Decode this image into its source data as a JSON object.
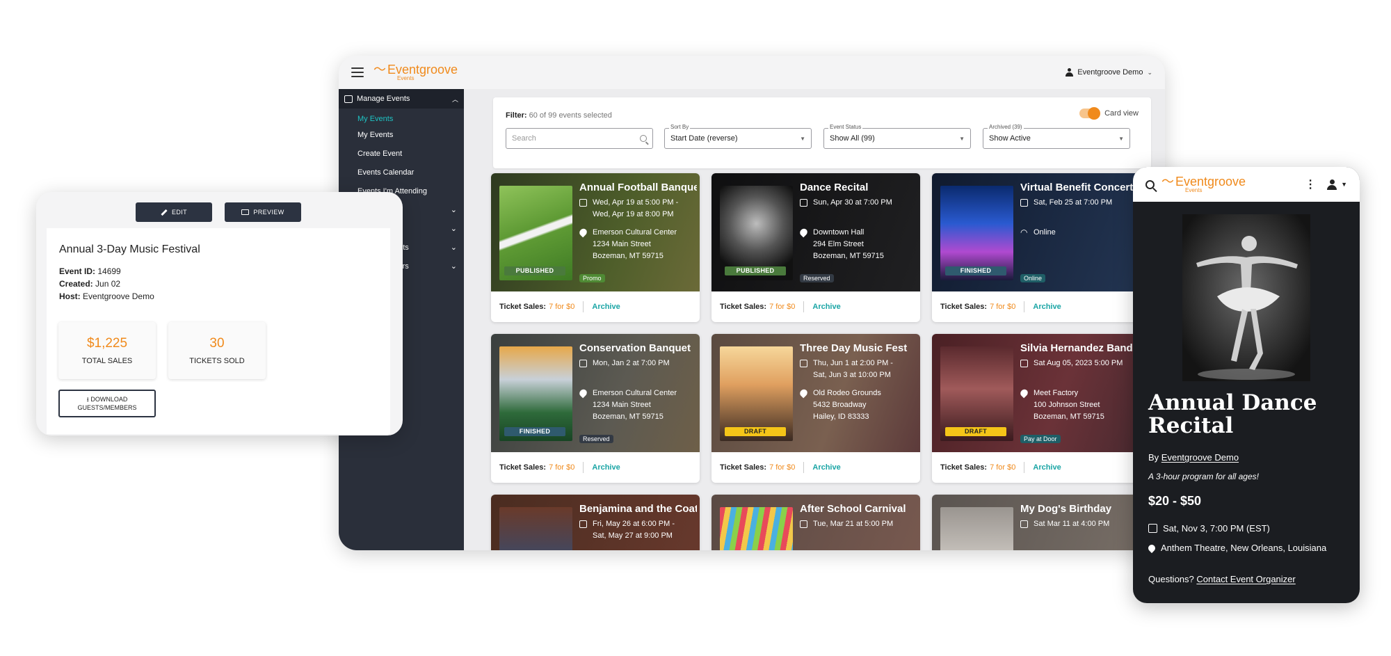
{
  "desktop": {
    "brand": "Eventgroove",
    "brand_sub": "Events",
    "user": "Eventgroove Demo",
    "sidebar": {
      "section": "Manage Events",
      "items": [
        "My Events",
        "My Events",
        "Create Event",
        "Events Calendar",
        "Events I'm Attending"
      ],
      "extra": [
        "",
        "",
        "ports",
        "Users"
      ]
    },
    "filter": {
      "label": "Filter:",
      "count": "60 of 99 events selected",
      "card_view": "Card view",
      "search_placeholder": "Search",
      "sort_label": "Sort By",
      "sort_value": "Start Date (reverse)",
      "status_label": "Event Status",
      "status_value": "Show All (99)",
      "archived_label": "Archived (39)",
      "archived_value": "Show Active"
    },
    "events": [
      {
        "title": "Annual Football Banquet",
        "date1": "Wed, Apr 19 at 5:00 PM -",
        "date2": "Wed, Apr 19 at 8:00 PM",
        "loc1": "Emerson Cultural Center",
        "loc2": "1234 Main Street",
        "loc3": "Bozeman, MT 59715",
        "status": "PUBLISHED",
        "tag": "Promo"
      },
      {
        "title": "Dance Recital",
        "date1": "Sun, Apr 30 at 7:00 PM",
        "date2": "",
        "loc1": "Downtown Hall",
        "loc2": "294 Elm Street",
        "loc3": "Bozeman, MT 59715",
        "status": "PUBLISHED",
        "tag": "Reserved"
      },
      {
        "title": "Virtual Benefit Concert",
        "date1": "Sat, Feb 25 at 7:00 PM",
        "date2": "",
        "loc1": "Online",
        "loc2": "",
        "loc3": "",
        "status": "FINISHED",
        "tag": "Online"
      },
      {
        "title": "Conservation Banquet",
        "date1": "Mon, Jan 2 at 7:00 PM",
        "date2": "",
        "loc1": "Emerson Cultural Center",
        "loc2": "1234 Main Street",
        "loc3": "Bozeman, MT 59715",
        "status": "FINISHED",
        "tag": "Reserved"
      },
      {
        "title": "Three Day Music Fest",
        "date1": "Thu, Jun 1 at 2:00 PM -",
        "date2": "Sat, Jun 3 at 10:00 PM",
        "loc1": "Old Rodeo Grounds",
        "loc2": "5432 Broadway",
        "loc3": "Hailey, ID 83333",
        "status": "DRAFT",
        "tag": ""
      },
      {
        "title": "Silvia Hernandez Band",
        "date1": "Sat Aug 05, 2023 5:00 PM",
        "date2": "",
        "loc1": "Meet Factory",
        "loc2": "100 Johnson Street",
        "loc3": "Bozeman, MT 59715",
        "status": "DRAFT",
        "tag": "Pay at Door"
      },
      {
        "title": "Benjamina and the Coat",
        "date1": "Fri, May 26 at 6:00 PM -",
        "date2": "Sat, May 27 at 9:00 PM",
        "loc1": "",
        "loc2": "",
        "loc3": "",
        "status": "",
        "tag": ""
      },
      {
        "title": "After School Carnival",
        "date1": "Tue, Mar 21 at 5:00 PM",
        "date2": "",
        "loc1": "",
        "loc2": "",
        "loc3": "",
        "status": "",
        "tag": ""
      },
      {
        "title": "My Dog's Birthday",
        "date1": "Sat Mar 11 at 4:00 PM",
        "date2": "",
        "loc1": "",
        "loc2": "",
        "loc3": "",
        "status": "",
        "tag": ""
      }
    ],
    "footer": {
      "label": "Ticket Sales:",
      "value": "7 for $0",
      "archive": "Archive"
    }
  },
  "panel": {
    "edit": "EDIT",
    "preview": "PREVIEW",
    "title": "Annual 3-Day Music Festival",
    "event_id_label": "Event ID:",
    "event_id": "14699",
    "created_label": "Created:",
    "created": "Jun 02",
    "host_label": "Host:",
    "host": "Eventgroove Demo",
    "total_sales": "$1,225",
    "total_sales_label": "TOTAL SALES",
    "tickets_sold": "30",
    "tickets_sold_label": "TICKETS SOLD",
    "download_line1": "DOWNLOAD",
    "download_line2": "GUESTS/MEMBERS"
  },
  "mobile": {
    "brand": "Eventgroove",
    "brand_sub": "Events",
    "title": "Annual Dance Recital",
    "by_label": "By",
    "by": "Eventgroove Demo",
    "description": "A 3-hour program for all ages!",
    "price": "$20 - $50",
    "date": "Sat, Nov 3, 7:00 PM (EST)",
    "location": "Anthem Theatre, New Orleans, Louisiana",
    "questions": "Questions?",
    "contact": "Contact Event Organizer"
  },
  "colors": {
    "accent": "#f08a1c",
    "teal": "#1aa5a5",
    "sidebar": "#2a2f3a"
  },
  "icons": [
    "hamburger-icon",
    "person-icon",
    "calendar-icon",
    "search-icon",
    "location-pin-icon",
    "wifi-icon",
    "pencil-icon",
    "monitor-icon",
    "download-icon",
    "more-vertical-icon"
  ]
}
